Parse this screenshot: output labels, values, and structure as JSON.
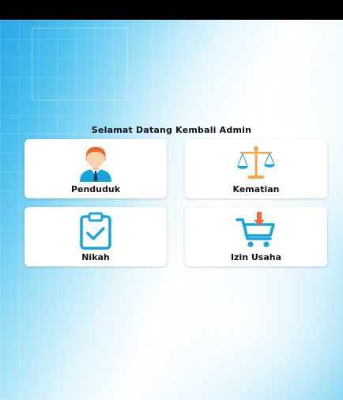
{
  "header": {
    "greeting": "Selamat Datang Kembali Admin"
  },
  "menu": [
    {
      "label": "Penduduk",
      "icon": "person-icon"
    },
    {
      "label": "Kematian",
      "icon": "scale-icon"
    },
    {
      "label": "Nikah",
      "icon": "clipboard-check-icon"
    },
    {
      "label": "Izin Usaha",
      "icon": "cart-download-icon"
    }
  ],
  "colors": {
    "card_bg": "#ffffff",
    "accent_blue": "#1aa3d9",
    "accent_orange": "#f4a64a",
    "text": "#111111"
  }
}
